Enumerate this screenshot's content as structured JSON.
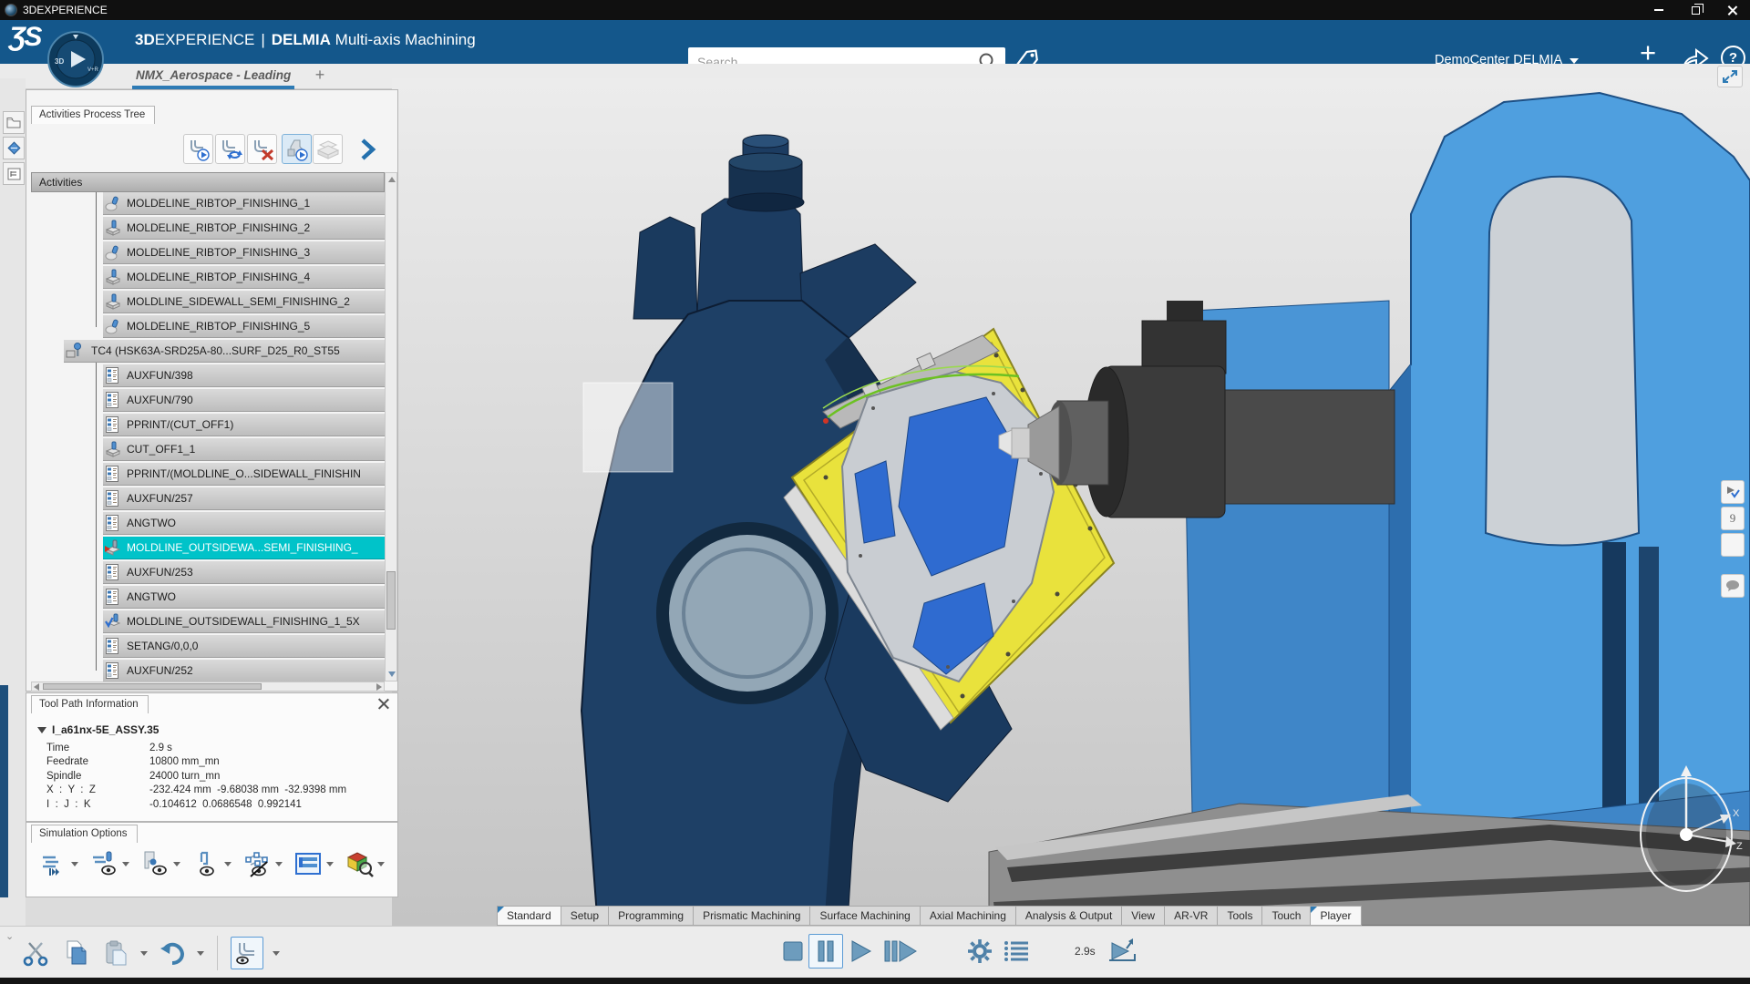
{
  "window": {
    "title": "3DEXPERIENCE"
  },
  "topbar": {
    "brand_bold": "3D",
    "brand_rest": "EXPERIENCE",
    "divider": "|",
    "product_bold": "DELMIA",
    "product_rest": "Multi-axis Machining",
    "search_placeholder": "Search",
    "user_menu_label": "DemoCenter DELMIA",
    "add_label": "+"
  },
  "doc_tab": {
    "label": "NMX_Aerospace - Leading",
    "add_label": "+"
  },
  "left_panel": {
    "tab_title": "Activities Process Tree",
    "tree_header": "Activities",
    "toolbar": [
      {
        "name": "play-toolpath",
        "state": "normal"
      },
      {
        "name": "update-toolpath",
        "state": "normal"
      },
      {
        "name": "remove-toolpath",
        "state": "normal"
      },
      {
        "name": "machine-simulation",
        "state": "active"
      },
      {
        "name": "stock-display",
        "state": "disabled"
      },
      {
        "name": "expand-more",
        "state": "normal"
      }
    ],
    "tree": [
      {
        "label": "MOLDELINE_RIBTOP_FINISHING_1",
        "icon": "op-curved",
        "level": 1,
        "selected": false
      },
      {
        "label": "MOLDELINE_RIBTOP_FINISHING_2",
        "icon": "op-block",
        "level": 1,
        "selected": false
      },
      {
        "label": "MOLDELINE_RIBTOP_FINISHING_3",
        "icon": "op-curved",
        "level": 1,
        "selected": false
      },
      {
        "label": "MOLDELINE_RIBTOP_FINISHING_4",
        "icon": "op-block",
        "level": 1,
        "selected": false
      },
      {
        "label": "MOLDLINE_SIDEWALL_SEMI_FINISHING_2",
        "icon": "op-block",
        "level": 1,
        "selected": false
      },
      {
        "label": "MOLDELINE_RIBTOP_FINISHING_5",
        "icon": "op-curved",
        "level": 1,
        "selected": false
      },
      {
        "label": "TC4 (HSK63A-SRD25A-80...SURF_D25_R0_ST55",
        "icon": "toolchange",
        "level": 0,
        "selected": false
      },
      {
        "label": "AUXFUN/398",
        "icon": "nc",
        "level": 1,
        "selected": false
      },
      {
        "label": "AUXFUN/790",
        "icon": "nc",
        "level": 1,
        "selected": false
      },
      {
        "label": "PPRINT/(CUT_OFF1)",
        "icon": "nc",
        "level": 1,
        "selected": false
      },
      {
        "label": "CUT_OFF1_1",
        "icon": "op-block",
        "level": 1,
        "selected": false
      },
      {
        "label": "PPRINT/(MOLDLINE_O...SIDEWALL_FINISHIN",
        "icon": "nc",
        "level": 1,
        "selected": false
      },
      {
        "label": "AUXFUN/257",
        "icon": "nc",
        "level": 1,
        "selected": false
      },
      {
        "label": "ANGTWO",
        "icon": "nc",
        "level": 1,
        "selected": false
      },
      {
        "label": "MOLDLINE_OUTSIDEWA...SEMI_FINISHING_",
        "icon": "op-block-current",
        "level": 1,
        "selected": true
      },
      {
        "label": "AUXFUN/253",
        "icon": "nc",
        "level": 1,
        "selected": false
      },
      {
        "label": "ANGTWO",
        "icon": "nc",
        "level": 1,
        "selected": false
      },
      {
        "label": "MOLDLINE_OUTSIDEWALL_FINISHING_1_5X",
        "icon": "op-block-check",
        "level": 1,
        "selected": false
      },
      {
        "label": "SETANG/0,0,0",
        "icon": "nc",
        "level": 1,
        "selected": false
      },
      {
        "label": "AUXFUN/252",
        "icon": "nc",
        "level": 1,
        "selected": false
      }
    ]
  },
  "tool_path_info": {
    "title": "Tool Path Information",
    "node_label": "I_a61nx-5E_ASSY.35",
    "rows": [
      {
        "label": "Time",
        "value": "2.9 s"
      },
      {
        "label": "Feedrate",
        "value": "10800 mm_mn"
      },
      {
        "label": "Spindle",
        "value": "24000 turn_mn"
      },
      {
        "label": "X  :  Y  :  Z",
        "value": "-232.424 mm  -9.68038 mm  -32.9398 mm"
      },
      {
        "label": "I  :  J  :  K",
        "value": "-0.104612  0.0686548  0.992141"
      }
    ]
  },
  "simulation_options": {
    "title": "Simulation Options",
    "buttons": [
      {
        "name": "sim-run-options"
      },
      {
        "name": "sim-tool-display"
      },
      {
        "name": "sim-material-removal"
      },
      {
        "name": "sim-tool-axis"
      },
      {
        "name": "sim-point-display"
      },
      {
        "name": "sim-information-table"
      },
      {
        "name": "sim-color-analysis"
      }
    ]
  },
  "workshop_tabs": [
    {
      "label": "Standard",
      "highlight": true
    },
    {
      "label": "Setup",
      "highlight": false
    },
    {
      "label": "Programming",
      "highlight": false
    },
    {
      "label": "Prismatic Machining",
      "highlight": false
    },
    {
      "label": "Surface Machining",
      "highlight": false
    },
    {
      "label": "Axial Machining",
      "highlight": false
    },
    {
      "label": "Analysis & Output",
      "highlight": false
    },
    {
      "label": "View",
      "highlight": false
    },
    {
      "label": "AR-VR",
      "highlight": false
    },
    {
      "label": "Tools",
      "highlight": false
    },
    {
      "label": "Touch",
      "highlight": false
    },
    {
      "label": "Player",
      "highlight": true,
      "active": true
    }
  ],
  "player": {
    "elapsed": "2.9s"
  },
  "colors": {
    "topbar_blue": "#14578b",
    "accent_blue": "#2e7bb5",
    "selection_teal": "#00c3c9",
    "machine_navy": "#1e4066",
    "machine_blue": "#4f9fdf",
    "fixture_yellow": "#e9e23c",
    "part_blue": "#2f6bd0",
    "toolpath_green": "#6cc122"
  }
}
